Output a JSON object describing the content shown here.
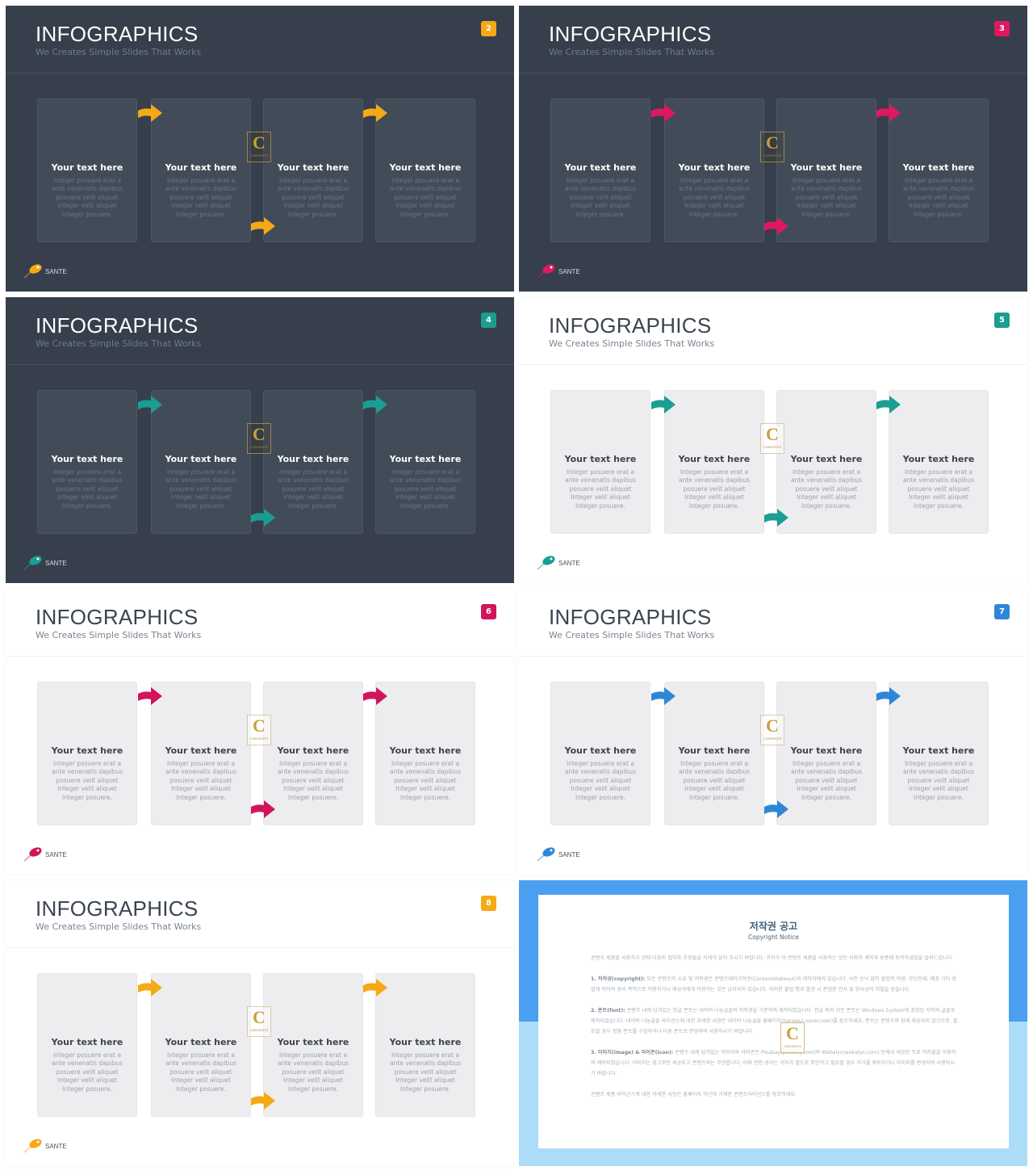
{
  "slides": [
    {
      "number": "2",
      "theme": "dark",
      "accent": "#f5a915",
      "title": "INFOGRAPHICS",
      "subtitle": "We Creates Simple Slides That Works",
      "cards": [
        {
          "title": "Your text here",
          "body": "Integer posuere erat a ante venenatis dapibus posuere velit aliquet Integer velit aliquet Integer posuere."
        },
        {
          "title": "Your text here",
          "body": "Integer posuere erat a ante venenatis dapibus posuere velit aliquet Integer velit aliquet Integer posuere."
        },
        {
          "title": "Your text here",
          "body": "Integer posuere erat a ante venenatis dapibus posuere velit aliquet Integer velit aliquet Integer posuere."
        },
        {
          "title": "Your text here",
          "body": "Integer posuere erat a ante venenatis dapibus posuere velit aliquet Integer velit aliquet Integer posuere."
        }
      ],
      "logo": "SANTE",
      "watermark": {
        "letter": "C",
        "text": "CONTENTS"
      }
    },
    {
      "number": "3",
      "theme": "dark",
      "accent": "#e0185f",
      "title": "INFOGRAPHICS",
      "subtitle": "We Creates Simple Slides That Works",
      "cards": [
        {
          "title": "Your text here",
          "body": "Integer posuere erat a ante venenatis dapibus posuere velit aliquet Integer velit aliquet Integer posuere."
        },
        {
          "title": "Your text here",
          "body": "Integer posuere erat a ante venenatis dapibus posuere velit aliquet Integer velit aliquet Integer posuere."
        },
        {
          "title": "Your text here",
          "body": "Integer posuere erat a ante venenatis dapibus posuere velit aliquet Integer velit aliquet Integer posuere."
        },
        {
          "title": "Your text here",
          "body": "Integer posuere erat a ante venenatis dapibus posuere velit aliquet Integer velit aliquet Integer posuere."
        }
      ],
      "logo": "SANTE",
      "watermark": {
        "letter": "C",
        "text": "CONTENTS"
      }
    },
    {
      "number": "4",
      "theme": "dark",
      "accent": "#1a9e93",
      "title": "INFOGRAPHICS",
      "subtitle": "We Creates Simple Slides That Works",
      "cards": [
        {
          "title": "Your text here",
          "body": "Integer posuere erat a ante venenatis dapibus posuere velit aliquet Integer velit aliquet Integer posuere."
        },
        {
          "title": "Your text here",
          "body": "Integer posuere erat a ante venenatis dapibus posuere velit aliquet Integer velit aliquet Integer posuere."
        },
        {
          "title": "Your text here",
          "body": "Integer posuere erat a ante venenatis dapibus posuere velit aliquet Integer velit aliquet Integer posuere."
        },
        {
          "title": "Your text here",
          "body": "Integer posuere erat a ante venenatis dapibus posuere velit aliquet Integer velit aliquet Integer posuere."
        }
      ],
      "logo": "SANTE",
      "watermark": {
        "letter": "C",
        "text": "CONTENTS"
      }
    },
    {
      "number": "5",
      "theme": "light",
      "accent": "#1a9e93",
      "title": "INFOGRAPHICS",
      "subtitle": "We Creates Simple Slides That Works",
      "cards": [
        {
          "title": "Your text here",
          "body": "Integer posuere erat a ante venenatis dapibus posuere velit aliquet Integer velit aliquet Integer posuere."
        },
        {
          "title": "Your text here",
          "body": "Integer posuere erat a ante venenatis dapibus posuere velit aliquet Integer velit aliquet Integer posuere."
        },
        {
          "title": "Your text here",
          "body": "Integer posuere erat a ante venenatis dapibus posuere velit aliquet Integer velit aliquet Integer posuere."
        },
        {
          "title": "Your text here",
          "body": "Integer posuere erat a ante venenatis dapibus posuere velit aliquet Integer velit aliquet Integer posuere."
        }
      ],
      "logo": "SANTE",
      "watermark": {
        "letter": "C",
        "text": "CONTENTS"
      }
    },
    {
      "number": "6",
      "theme": "light",
      "accent": "#d2155a",
      "title": "INFOGRAPHICS",
      "subtitle": "We Creates Simple Slides That Works",
      "cards": [
        {
          "title": "Your text here",
          "body": "Integer posuere erat a ante venenatis dapibus posuere velit aliquet Integer velit aliquet Integer posuere."
        },
        {
          "title": "Your text here",
          "body": "Integer posuere erat a ante venenatis dapibus posuere velit aliquet Integer velit aliquet Integer posuere."
        },
        {
          "title": "Your text here",
          "body": "Integer posuere erat a ante venenatis dapibus posuere velit aliquet Integer velit aliquet Integer posuere."
        },
        {
          "title": "Your text here",
          "body": "Integer posuere erat a ante venenatis dapibus posuere velit aliquet Integer velit aliquet Integer posuere."
        }
      ],
      "logo": "SANTE",
      "watermark": {
        "letter": "C",
        "text": "CONTENTS"
      }
    },
    {
      "number": "7",
      "theme": "light",
      "accent": "#2f86d8",
      "title": "INFOGRAPHICS",
      "subtitle": "We Creates Simple Slides That Works",
      "cards": [
        {
          "title": "Your text here",
          "body": "Integer posuere erat a ante venenatis dapibus posuere velit aliquet Integer velit aliquet Integer posuere."
        },
        {
          "title": "Your text here",
          "body": "Integer posuere erat a ante venenatis dapibus posuere velit aliquet Integer velit aliquet Integer posuere."
        },
        {
          "title": "Your text here",
          "body": "Integer posuere erat a ante venenatis dapibus posuere velit aliquet Integer velit aliquet Integer posuere."
        },
        {
          "title": "Your text here",
          "body": "Integer posuere erat a ante venenatis dapibus posuere velit aliquet Integer velit aliquet Integer posuere."
        }
      ],
      "logo": "SANTE",
      "watermark": {
        "letter": "C",
        "text": "CONTENTS"
      }
    },
    {
      "number": "8",
      "theme": "light",
      "accent": "#f5a915",
      "title": "INFOGRAPHICS",
      "subtitle": "We Creates Simple Slides That Works",
      "cards": [
        {
          "title": "Your text here",
          "body": "Integer posuere erat a ante venenatis dapibus posuere velit aliquet Integer velit aliquet Integer posuere."
        },
        {
          "title": "Your text here",
          "body": "Integer posuere erat a ante venenatis dapibus posuere velit aliquet Integer velit aliquet Integer posuere."
        },
        {
          "title": "Your text here",
          "body": "Integer posuere erat a ante venenatis dapibus posuere velit aliquet Integer velit aliquet Integer posuere."
        },
        {
          "title": "Your text here",
          "body": "Integer posuere erat a ante venenatis dapibus posuere velit aliquet Integer velit aliquet Integer posuere."
        }
      ],
      "logo": "SANTE",
      "watermark": {
        "letter": "C",
        "text": "CONTENTS"
      }
    }
  ],
  "copyright": {
    "title": "저작권 공고",
    "subtitle": "Copyright Notice",
    "intro": "콘텐츠 제품을 사용하기 전에 다음의 협약과 조항들을 자세히 읽어 주시기 바랍니다. 귀하가 이 콘텐츠 제품을 사용하는 것은 사용자 계약과 보증에 동의하셨음을 알려드립니다.",
    "sections": [
      {
        "heading": "1. 저작권(copyright):",
        "text": " 모든 콘텐츠의 소유 및 저작권은 콘텐츠테이크아웃(Contentstakeout)과 제작자에게 있습니다. 사전 승낙 없이 불법적 이용, 무단전재, 배포 기타 방법에 의하여 영리 목적으로 이용하거나 제삼자에게 이용하는 것은 금지되어 있습니다. 이러한 불법 행위 발견 시 준엄한 민사 및 형사상의 처벌을 받습니다."
      },
      {
        "heading": "2. 폰트(font):",
        "text": " 콘텐츠 내에 담겨있는 한글 폰트는 네이버 나눔글꼴의 저작권을 기준하여 제작되었습니다. 한글 외의 모든 폰트는 Windows System에 포함된 저작의 글꼴로 제작되었습니다. 네이버 나눔글꼴 라이선스에 대한 자세한 사항은 네이버 나눔글꼴 홈페이지(hangeul.naver.com)를 참조하세요. 폰트는 콘텐츠와 함께 제공되지 않으므로, 필요할 경우 정품 폰트를 구입하거나 다른 폰트로 변경하여 사용하시기 바랍니다."
      },
      {
        "heading": "3. 이미지(image) & 아이콘(icon):",
        "text": " 콘텐츠 내에 담겨있는 이미지와 아이콘은 Pixabay(pixabay.com)와 Webalys(webalys.com) 등에서 제공한 무료 저작물을 이용하여 제작되었습니다. 이미지는 참고로만 제공되고 콘텐츠와는 무관합니다. 이에 관한 권리는 귀하가 별도로 확인하고 필요할 경우 허가를 취득하거나 이미지를 변경하여 사용하시기 바랍니다."
      }
    ],
    "footer": "콘텐츠 제품 라이선스에 대한 자세한 사항은 홈페이지 하단에 기재한 콘텐츠라이선스를 참조하세요.",
    "watermark": {
      "letter": "C",
      "text": "CONTENTS"
    },
    "colors": {
      "top": "#4a9ff0",
      "bottom": "#addcf9"
    }
  }
}
